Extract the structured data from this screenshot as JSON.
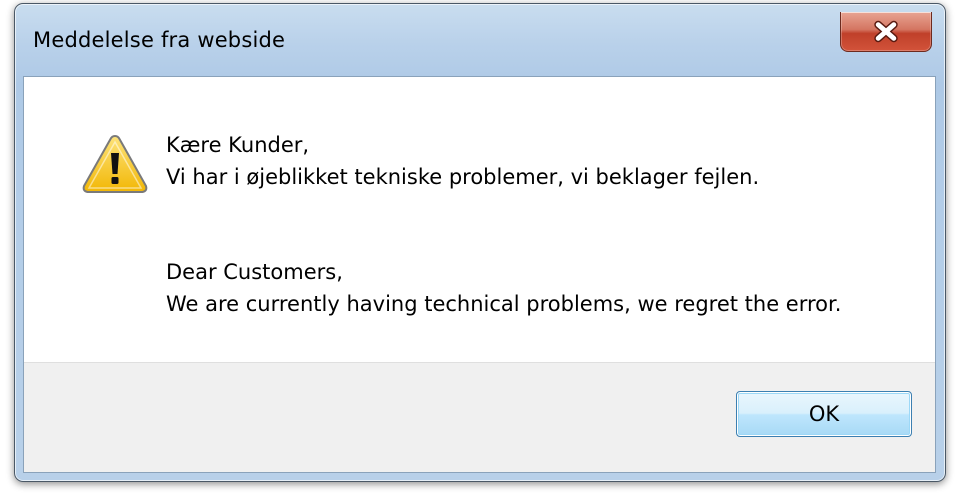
{
  "dialog": {
    "title": "Meddelelse fra webside",
    "close_button_label": "X",
    "icon": "warning-icon",
    "message_danish": {
      "greeting": "Kære Kunder,",
      "body": "Vi har i øjeblikket tekniske problemer, vi beklager fejlen."
    },
    "message_english": {
      "greeting": "Dear Customers,",
      "body": "We are currently having technical problems, we regret the error."
    },
    "ok_label": "OK"
  },
  "colors": {
    "frame": "#b9d1ea",
    "close_button": "#c7452f",
    "warning_triangle": "#f6c623",
    "button_area": "#f0f0f0",
    "ok_border": "#3c7fb1"
  }
}
